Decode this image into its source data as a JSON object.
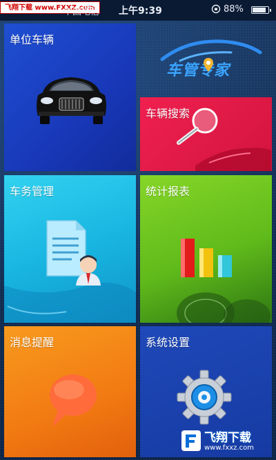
{
  "status_bar": {
    "watermark": "飞翔下载 www.FXXZ.com",
    "carrier": "中国电信",
    "time": "上午9:39",
    "battery": "88%",
    "battery_level": 0.88
  },
  "app": {
    "logo_text": "车管专家"
  },
  "tiles": {
    "vehicles": {
      "label": "单位车辆"
    },
    "search": {
      "label": "车辆搜索"
    },
    "affairs": {
      "label": "车务管理"
    },
    "stats": {
      "label": "统计报表"
    },
    "messages": {
      "label": "消息提醒"
    },
    "settings": {
      "label": "系统设置"
    }
  },
  "watermark_bottom": {
    "brand": "飞翔下载",
    "url": "www.fxxz.com"
  },
  "colors": {
    "vehicles_tile": "#1f4fd1",
    "search_tile": "#f0204f",
    "affairs_tile": "#19b6e2",
    "stats_tile": "#5fba1b",
    "messages_tile": "#f27a12",
    "settings_tile": "#163aa2",
    "logo_text": "#3aa4ff"
  },
  "icons": {
    "vehicles": "car-icon",
    "search": "magnifier-icon",
    "affairs": "document-person-icon",
    "stats": "bar-chart-icon",
    "messages": "speech-bubble-icon",
    "settings": "gear-icon"
  }
}
